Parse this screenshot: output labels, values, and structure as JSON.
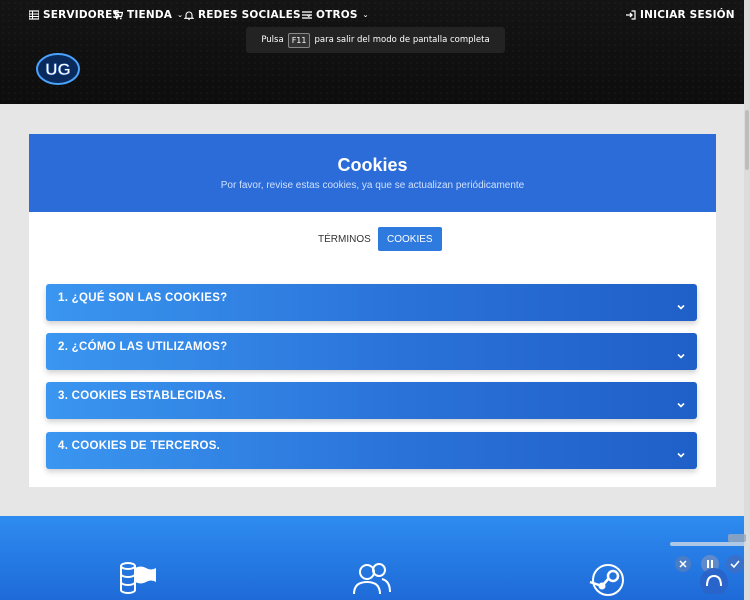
{
  "nav": {
    "servidores": "SERVIDORES",
    "tienda": "TIENDA",
    "redes": "REDES SOCIALES",
    "otros": "OTROS",
    "login": "INICIAR SESIÓN"
  },
  "fullscreen_notice": {
    "prefix": "Pulsa",
    "key": "F11",
    "suffix": "para salir del modo de pantalla completa"
  },
  "logo": {
    "text": "UG"
  },
  "page": {
    "title": "Cookies",
    "subtitle": "Por favor, revise estas cookies, ya que se actualizan periódicamente"
  },
  "tabs": [
    {
      "label": "TÉRMINOS",
      "active": false
    },
    {
      "label": "COOKIES",
      "active": true
    }
  ],
  "sections": [
    {
      "label": "1. ¿QUÉ SON LAS COOKIES?"
    },
    {
      "label": "2. ¿CÓMO LAS UTILIZAMOS?"
    },
    {
      "label": "3. COOKIES ESTABLECIDAS."
    },
    {
      "label": "4. COOKIES DE TERCEROS."
    }
  ],
  "colors": {
    "header_bg": "#111111",
    "card_header": "#2b6cd8",
    "active_tab": "#2f7adf",
    "accordion": "#2a72d8",
    "footer": "#2480e8"
  },
  "icons": [
    "list-icon",
    "cart-icon",
    "bell-icon",
    "menu-icon",
    "login-icon",
    "chevron-down-icon",
    "server-flag-icon",
    "users-icon",
    "steam-icon"
  ]
}
